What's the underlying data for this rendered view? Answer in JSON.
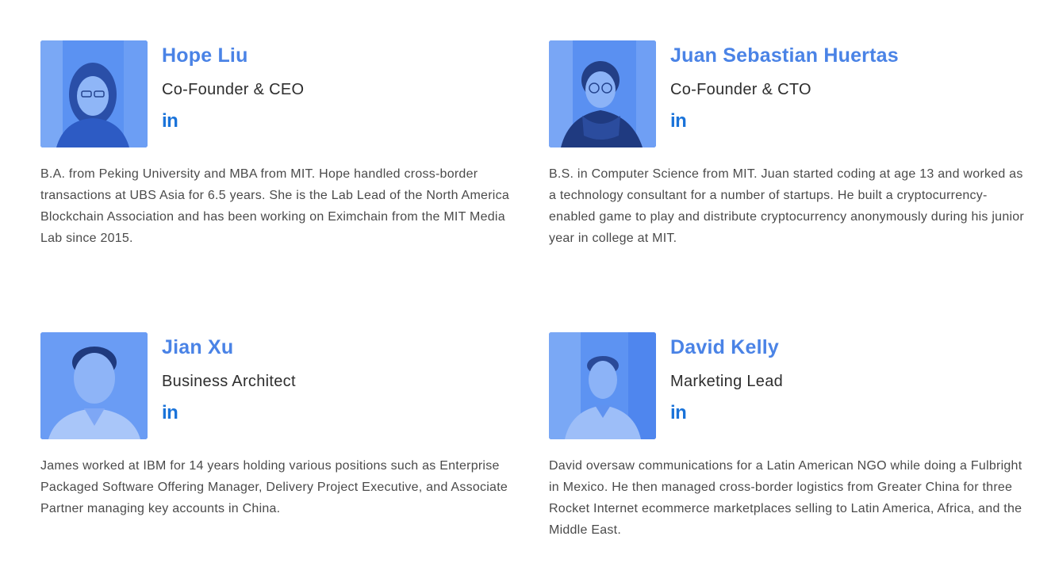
{
  "team": [
    {
      "name": "Hope Liu",
      "role": "Co-Founder & CEO",
      "social_icon": "linkedin-icon",
      "social_label": "in",
      "bio": "B.A. from Peking University and MBA from MIT. Hope handled cross-border transactions at UBS Asia for 6.5 years. She is the Lab Lead of the North America Blockchain Association and has been working on Eximchain from the MIT Media Lab since 2015."
    },
    {
      "name": "Juan Sebastian Huertas",
      "role": "Co-Founder & CTO",
      "social_icon": "linkedin-icon",
      "social_label": "in",
      "bio": "B.S. in Computer Science from MIT. Juan started coding at age 13 and worked as a technology consultant for a number of startups. He built a cryptocurrency-enabled game to play and distribute cryptocurrency anonymously during his junior year in college at MIT."
    },
    {
      "name": "Jian Xu",
      "role": "Business Architect",
      "social_icon": "linkedin-icon",
      "social_label": "in",
      "bio": "James worked at IBM for 14 years holding various positions such as Enterprise Packaged Software Offering Manager, Delivery Project Executive, and Associate Partner managing key accounts in China."
    },
    {
      "name": "David Kelly",
      "role": "Marketing Lead",
      "social_icon": "linkedin-icon",
      "social_label": "in",
      "bio": "David oversaw communications for a Latin American NGO while doing a Fulbright in Mexico. He then managed cross-border logistics from Greater China for three Rocket Internet ecommerce marketplaces selling to Latin America, Africa, and the Middle East."
    }
  ],
  "colors": {
    "name": "#4a83e6",
    "linkedin": "#1a73d9",
    "photo_tint": "#4a86f0"
  }
}
